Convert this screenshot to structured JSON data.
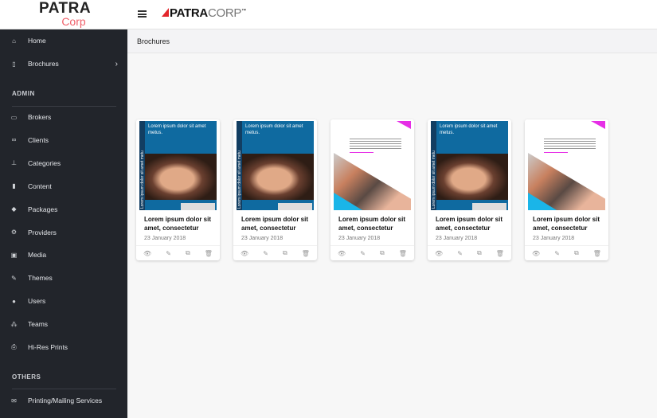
{
  "header": {
    "logo_top": "PATRA",
    "logo_bottom": "Corp",
    "brand_bold": "PATRA",
    "brand_light": "CORP",
    "brand_tm": "™"
  },
  "sidebar": {
    "items": [
      {
        "label": "Home",
        "icon": "home-icon"
      },
      {
        "label": "Brochures",
        "icon": "file-icon"
      }
    ],
    "admin_label": "ADMIN",
    "admin_items": [
      {
        "label": "Brokers",
        "icon": "id-card-icon"
      },
      {
        "label": "Clients",
        "icon": "handshake-icon"
      },
      {
        "label": "Categories",
        "icon": "sitemap-icon"
      },
      {
        "label": "Content",
        "icon": "document-icon"
      },
      {
        "label": "Packages",
        "icon": "tag-icon"
      },
      {
        "label": "Providers",
        "icon": "cogs-icon"
      },
      {
        "label": "Media",
        "icon": "image-icon"
      },
      {
        "label": "Themes",
        "icon": "brush-icon"
      },
      {
        "label": "Users",
        "icon": "users-icon"
      },
      {
        "label": "Teams",
        "icon": "team-icon"
      },
      {
        "label": "Hi-Res Prints",
        "icon": "print-icon"
      }
    ],
    "others_label": "OTHERS",
    "other_items": [
      {
        "label": "Printing/Mailing Services",
        "icon": "envelope-icon"
      }
    ]
  },
  "breadcrumb": "Brochures",
  "cards": [
    {
      "style": "blue",
      "cover_text": "Lorem ipsum dolor sit amet metus.",
      "spine_text": "Lorem ipsum dolor sit amet metu",
      "title": "Lorem ipsum dolor sit amet, consectetur",
      "date": "23 January 2018"
    },
    {
      "style": "blue",
      "cover_text": "Lorem ipsum dolor sit amet metus.",
      "spine_text": "Lorem ipsum dolor sit amet metu",
      "title": "Lorem ipsum dolor sit amet, consectetur",
      "date": "23 January 2018"
    },
    {
      "style": "white",
      "title": "Lorem ipsum dolor sit amet, consectetur",
      "date": "23 January 2018"
    },
    {
      "style": "blue",
      "cover_text": "Lorem ipsum dolor sit amet metus.",
      "spine_text": "Lorem ipsum dolor sit amet metu",
      "title": "Lorem ipsum dolor sit amet, consectetur",
      "date": "23 January 2018"
    },
    {
      "style": "white",
      "title": "Lorem ipsum dolor sit amet, consectetur",
      "date": "23 January 2018"
    }
  ]
}
